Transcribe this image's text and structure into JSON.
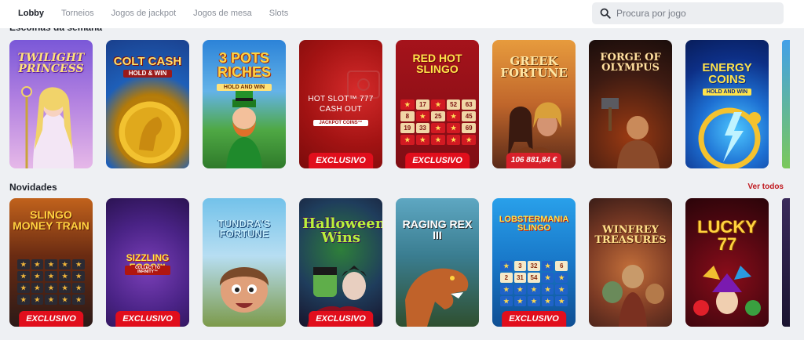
{
  "nav": {
    "tabs": [
      {
        "label": "Lobby",
        "active": true
      },
      {
        "label": "Torneios",
        "active": false
      },
      {
        "label": "Jogos de jackpot",
        "active": false
      },
      {
        "label": "Jogos de mesa",
        "active": false
      },
      {
        "label": "Slots",
        "active": false
      }
    ]
  },
  "search": {
    "placeholder": "Procura por jogo",
    "icon": "search-icon"
  },
  "sections": [
    {
      "title": "Escolhas da semana",
      "games": [
        {
          "name": "Twilight Princess",
          "logo": "TWILIGHT PRINCESS",
          "badge": ""
        },
        {
          "name": "Colt Cash Hold & Win",
          "logo": "COLT CASH",
          "sub": "HOLD & WIN",
          "badge": ""
        },
        {
          "name": "3 Pots Riches Hold and Win",
          "logo": "3 POTS RICHES",
          "sub": "HOLD AND WIN",
          "badge": ""
        },
        {
          "name": "Hot Slot 777 Cash Out",
          "logo": "HOT SLOT™ 777 CASH OUT",
          "sub": "JACKPOT COINS™",
          "badge": "EXCLUSIVO"
        },
        {
          "name": "Red Hot Slingo",
          "logo": "RED HOT SLINGO",
          "badge": "EXCLUSIVO"
        },
        {
          "name": "Greek Fortune",
          "logo": "GREEK FORTUNE",
          "badge": "106 881,84 €"
        },
        {
          "name": "Forge of Olympus",
          "logo": "FORGE OF OLYMPUS",
          "badge": ""
        },
        {
          "name": "Energy Coins Hold and Win",
          "logo": "ENERGY COINS",
          "sub": "HOLD AND WIN",
          "badge": ""
        }
      ]
    },
    {
      "title": "Novidades",
      "see_all": "Ver todos",
      "games": [
        {
          "name": "Slingo Money Train",
          "logo": "SLINGO MONEY TRAIN",
          "badge": "EXCLUSIVO"
        },
        {
          "name": "Sizzling Eggs",
          "logo": "SIZZLING EGGS™",
          "sub": "COLLECT TO INFINITY™",
          "badge": "EXCLUSIVO"
        },
        {
          "name": "Tundra's Fortune",
          "logo": "TUNDRA'S FORTUNE",
          "badge": ""
        },
        {
          "name": "Halloween Wins",
          "logo": "Halloween Wins",
          "badge": "EXCLUSIVO"
        },
        {
          "name": "Raging Rex III",
          "logo": "RAGING REX III",
          "badge": ""
        },
        {
          "name": "Lucky Larry's Lobstermania Slingo",
          "logo": "LOBSTERMANIA SLINGO",
          "badge": "EXCLUSIVO"
        },
        {
          "name": "Winfrey Treasures",
          "logo": "WINFREY TREASURES",
          "badge": ""
        },
        {
          "name": "Lucky 77",
          "logo": "LUCKY 77",
          "badge": ""
        }
      ]
    }
  ],
  "grids": {
    "red_hot_slingo": [
      "",
      "17",
      "",
      "52",
      "63",
      "8",
      "",
      "25",
      "",
      "45",
      "19",
      "33",
      "",
      "",
      "69",
      "",
      "",
      "",
      "",
      ""
    ],
    "lobstermania": [
      "★",
      "3",
      "32",
      "",
      "6",
      "2",
      "31",
      "54",
      "",
      "",
      "",
      "",
      "",
      "",
      "",
      "",
      "",
      "",
      "",
      ""
    ]
  },
  "colors": {
    "accent": "#e10e1c",
    "see_all": "#c0191f",
    "background": "#eef0f3"
  }
}
